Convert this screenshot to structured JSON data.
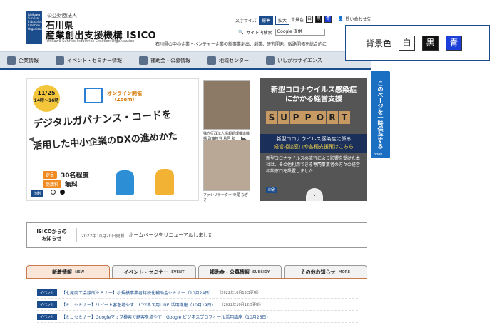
{
  "header": {
    "org_small": "公益財団法人",
    "org_name_line1": "石川県",
    "org_name_line2": "産業創出支援機構 ISICO",
    "org_en": "Ishikawa Sunrise Industries Creation Organization",
    "text_size_label": "文字サイズ",
    "text_size_standard": "標準",
    "text_size_large": "拡大",
    "bg_color_label": "背景色",
    "bg_white": "白",
    "bg_black": "黒",
    "bg_blue": "青",
    "contact": "問い合わせ先",
    "site_search_label": "サイト内検索",
    "search_placeholder": "Google 提供",
    "tagline": "石川県の中小企業・ベンチャー企業の新事業創出、創業、研究開発、販路開拓を総合的に"
  },
  "popup": {
    "label": "背景色",
    "white": "白",
    "black": "黒",
    "blue": "青"
  },
  "nav": {
    "items": [
      {
        "label": "企業情報"
      },
      {
        "label": "イベント・セミナー情報"
      },
      {
        "label": "補助金・公募情報"
      },
      {
        "label": "地域センター"
      },
      {
        "label": "いしかわサイエンス"
      }
    ]
  },
  "side_tab": {
    "label": "このページを一時保存する",
    "open": "open"
  },
  "banner": {
    "date": "11/25",
    "weekday": "火",
    "time": "14時～16時",
    "online_line1": "オンライン開催",
    "online_line2": "（Zoom）",
    "title_line1": "デジタルガバナンス・コードを",
    "title_line2": "活用した中小企業のDXの進めかた",
    "capacity_label": "定員",
    "capacity_value": "30名程度",
    "fee_label": "受講料",
    "fee_value": "無料",
    "print": "印刷"
  },
  "speakers": {
    "caption1": "独立行政法人情報処理推進機構 政策担当 鳥居 和一",
    "caption2": "ファシリテーター 寺尾 なぎさ"
  },
  "covid": {
    "title_line1": "新型コロナウイルス感染症",
    "title_line2": "にかかる経営支援",
    "support": [
      "S",
      "U",
      "P",
      "P",
      "O",
      "R",
      "T"
    ],
    "band_line1": "新型コロナウイルス感染症に係る",
    "band_line2": "経営相談窓口や各種支援策はこちら",
    "body": "新型コロナウイルスの流行により影響を受けた本社は、その他利用できる専門事業者の方々の経営相談窓口を設置しました",
    "print": "印刷"
  },
  "news": {
    "label_line1": "ISICOからの",
    "label_line2": "お知らせ",
    "date": "2022年10月20日更新",
    "text": "ホームページをリニューアルしました"
  },
  "tabs": [
    {
      "label": "新着情報",
      "en": "NEW"
    },
    {
      "label": "イベント・セミナー",
      "en": "EVENT"
    },
    {
      "label": "補助金・公募情報",
      "en": "SUBSIDY"
    },
    {
      "label": "その他お知らせ",
      "en": "MORE"
    }
  ],
  "list": [
    {
      "badge": "イベント",
      "title": "【七尾商工会議所セミナー】小規模事業者持続化補助金セミナー（10月24日）",
      "date": "（2022年10月13日更新）"
    },
    {
      "badge": "イベント",
      "title": "【ミニセミナー】リピート客を増やす！ビジネス用LINE 活用講座（10月19日）",
      "date": "（2022年10月12日更新）"
    },
    {
      "badge": "イベント",
      "title": "【ミニセミナー】Googleマップ検索で顧客を増やす！Google ビジネスプロフィール活用講座（10月26日）",
      "date": ""
    }
  ]
}
